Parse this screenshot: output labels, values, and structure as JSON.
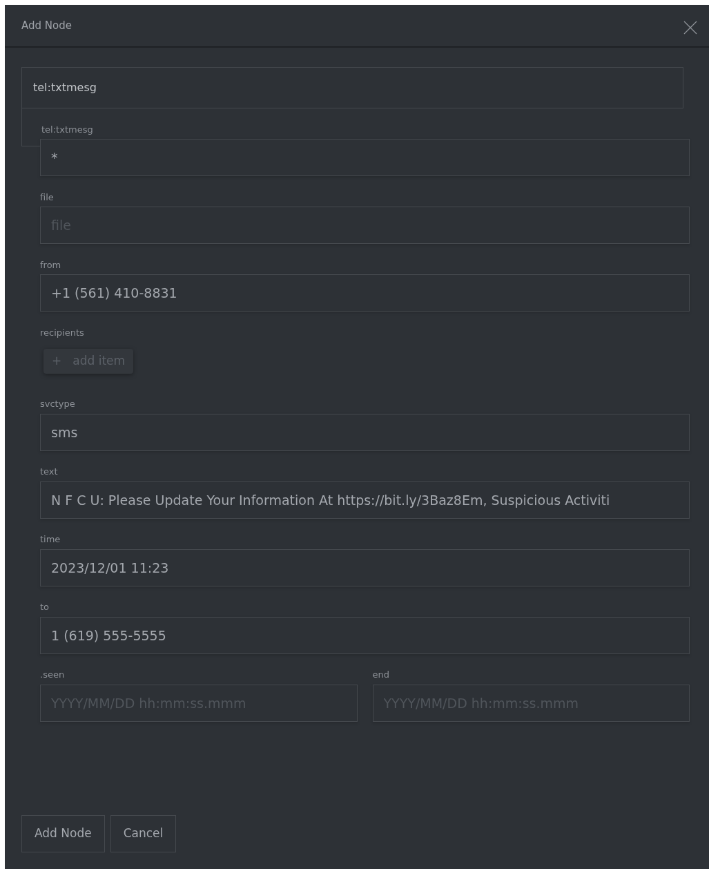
{
  "dialog": {
    "title": "Add Node"
  },
  "type_select": {
    "value": "tel:txtmesg"
  },
  "section_label": "tel:txtmesg",
  "fields": [
    {
      "kind": "text",
      "value": "*"
    },
    {
      "kind": "text",
      "label": "file",
      "placeholder": "file"
    },
    {
      "kind": "text",
      "label": "from",
      "value": "+1 (561) 410-8831"
    },
    {
      "kind": "list",
      "label": "recipients",
      "add_button": {
        "icon": "+",
        "label": "add item",
        "disabled": true
      }
    },
    {
      "kind": "text",
      "label": "svctype",
      "value": "sms"
    },
    {
      "kind": "text",
      "label": "text",
      "value": "N F C U: Please Update Your Information At https://bit.ly/3Baz8Em, Suspicious Activiti"
    },
    {
      "kind": "text",
      "label": "time",
      "value": "2023/12/01 11:23"
    },
    {
      "kind": "text",
      "label": "to",
      "value": "1 (619) 555-5555"
    },
    {
      "kind": "pair",
      "items": [
        {
          "label": ".seen",
          "placeholder": "YYYY/MM/DD hh:mm:ss.mmm"
        },
        {
          "label": "end",
          "placeholder": "YYYY/MM/DD hh:mm:ss.mmm"
        }
      ]
    }
  ],
  "buttons": [
    "Add Node",
    "Cancel"
  ]
}
